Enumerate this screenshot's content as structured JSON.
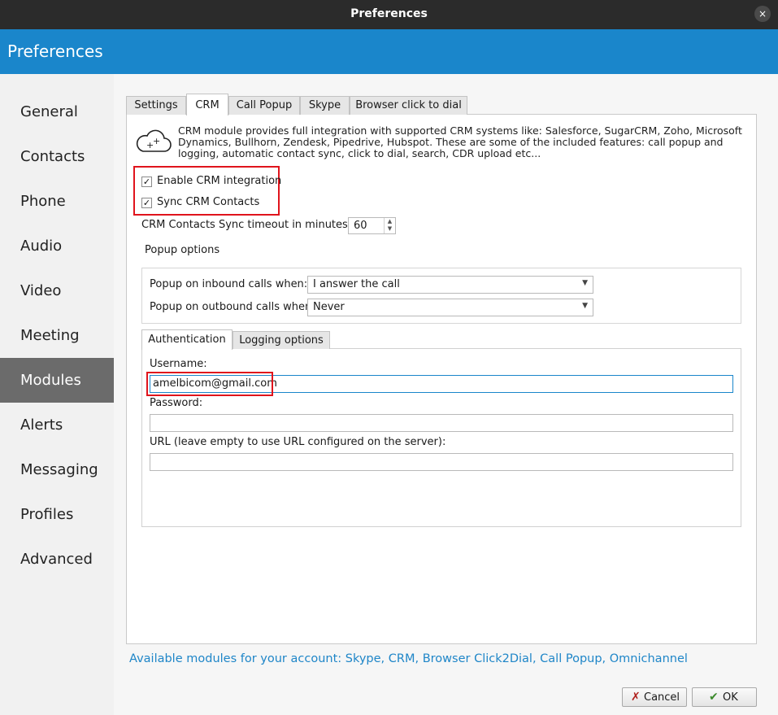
{
  "window": {
    "title": "Preferences",
    "close_icon": "×"
  },
  "header": {
    "title": "Preferences"
  },
  "sidebar": {
    "items": [
      {
        "label": "General"
      },
      {
        "label": "Contacts"
      },
      {
        "label": "Phone"
      },
      {
        "label": "Audio"
      },
      {
        "label": "Video"
      },
      {
        "label": "Meeting"
      },
      {
        "label": "Modules",
        "active": true
      },
      {
        "label": "Alerts"
      },
      {
        "label": "Messaging"
      },
      {
        "label": "Profiles"
      },
      {
        "label": "Advanced"
      }
    ]
  },
  "tabs": [
    {
      "label": "Settings"
    },
    {
      "label": "CRM",
      "active": true
    },
    {
      "label": "Call Popup"
    },
    {
      "label": "Skype"
    },
    {
      "label": "Browser click to dial"
    }
  ],
  "crm": {
    "description": "CRM module provides full integration with supported CRM systems like: Salesforce, SugarCRM, Zoho, Microsoft Dynamics, Bullhorn, Zendesk, Pipedrive, Hubspot. These are some of the included features: call popup and logging, automatic contact sync, click to dial, search, CDR upload etc...",
    "icon": "cloud-plus-icon",
    "enable_label": "Enable CRM integration",
    "enable_checked": true,
    "sync_label": "Sync CRM Contacts",
    "sync_checked": true,
    "check_mark": "✓",
    "timeout_label": "CRM Contacts Sync timeout in minutes",
    "timeout_value": "60",
    "popup_options_title": "Popup options",
    "inbound_label": "Popup on inbound calls when:",
    "inbound_value": "I answer the call",
    "outbound_label": "Popup on outbound calls when:",
    "outbound_value": "Never"
  },
  "subtabs": [
    {
      "label": "Authentication",
      "active": true
    },
    {
      "label": "Logging options"
    }
  ],
  "auth": {
    "username_label": "Username:",
    "username_value": "amelbicom@gmail.com",
    "password_label": "Password:",
    "password_value": "",
    "url_label": "URL (leave empty to use URL configured on the server):",
    "url_value": ""
  },
  "footer": {
    "modules_text": "Available modules for your account: Skype, CRM, Browser Click2Dial, Call Popup, Omnichannel",
    "cancel_label": "Cancel",
    "ok_label": "OK"
  },
  "colors": {
    "accent": "#1a86cb",
    "highlight": "#e0141c",
    "sidebar_active": "#6b6b6b"
  }
}
